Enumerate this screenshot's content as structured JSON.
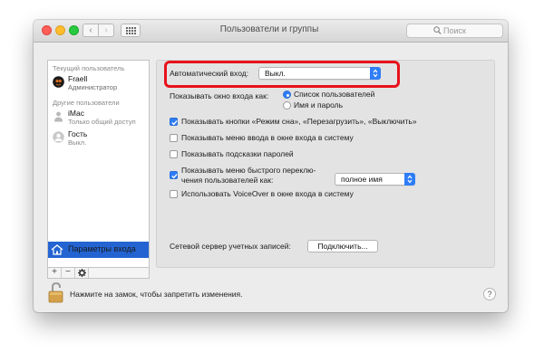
{
  "window": {
    "title": "Пользователи и группы",
    "search_placeholder": "Поиск",
    "nav_back": "‹",
    "nav_forward": "›"
  },
  "sidebar": {
    "current_header": "Текущий пользователь",
    "current_user": {
      "name": "Fraell",
      "role": "Администратор"
    },
    "other_header": "Другие пользователи",
    "other_users": [
      {
        "name": "iMac",
        "role": "Только общий доступ"
      },
      {
        "name": "Гость",
        "role": "Выкл."
      }
    ],
    "login_options_label": "Параметры входа",
    "toolbar": {
      "add": "+",
      "remove": "−"
    }
  },
  "login_options": {
    "auto_login_label": "Автоматический вход:",
    "auto_login_value": "Выкл.",
    "display_window_label": "Показывать окно входа как:",
    "radio_users_list": "Список пользователей",
    "radio_name_password": "Имя и пароль",
    "radio_selected": "users_list",
    "checkboxes": [
      {
        "label": "Показывать кнопки «Режим сна», «Перезагрузить», «Выключить»",
        "checked": true
      },
      {
        "label": "Показывать меню ввода в окне входа в систему",
        "checked": false
      },
      {
        "label": "Показывать подсказки паролей",
        "checked": false
      }
    ],
    "fast_switch_line1": "Показывать меню быстрого переклю-",
    "fast_switch_line2": "чения пользователей как:",
    "fast_switch_checked": true,
    "fast_switch_value": "полное имя",
    "voiceover_label": "Использовать VoiceOver в окне входа в систему",
    "voiceover_checked": false,
    "network_server_label": "Сетевой сервер учетных записей:",
    "connect_button": "Подключить..."
  },
  "footer": {
    "lock_text": "Нажмите на замок, чтобы запретить изменения.",
    "help": "?"
  },
  "colors": {
    "accent": "#2f7df6",
    "highlight": "#e8121b",
    "selection": "#2464d2"
  }
}
